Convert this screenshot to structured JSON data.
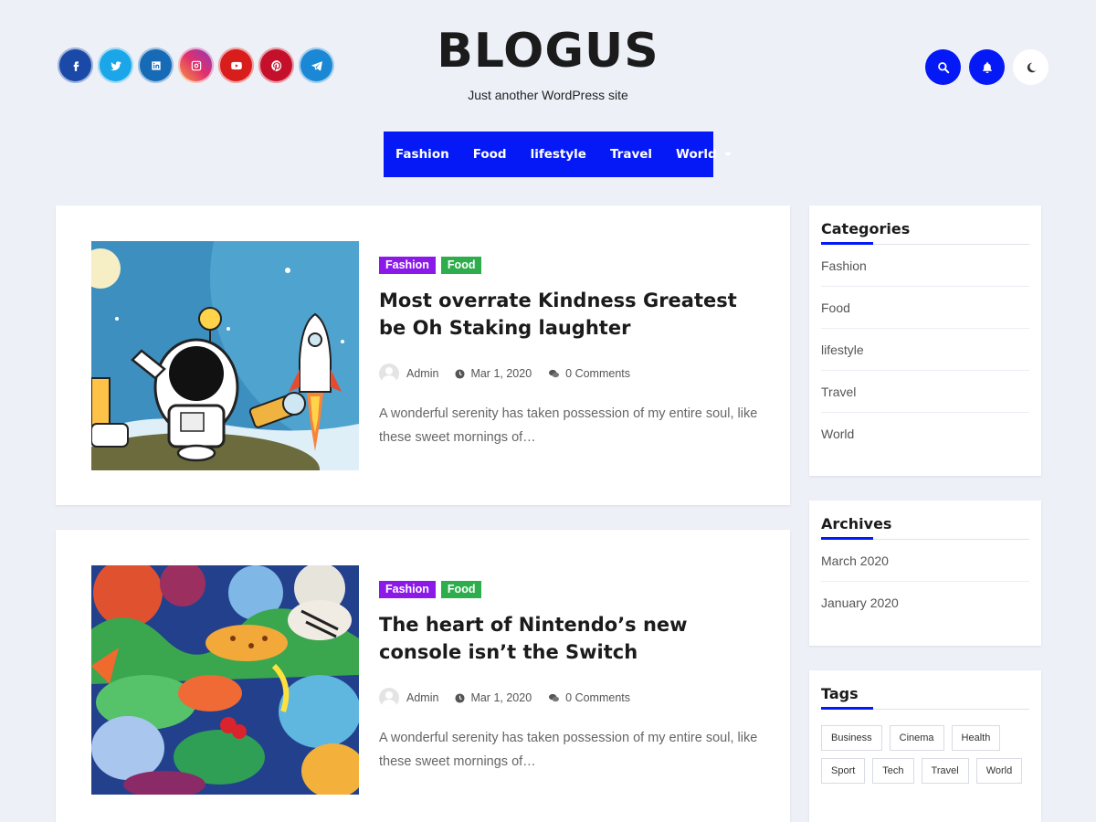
{
  "site": {
    "title": "BLOGUS",
    "tagline": "Just another WordPress site"
  },
  "social": [
    {
      "name": "facebook",
      "color": "#1a49a8",
      "icon": "facebook-icon"
    },
    {
      "name": "twitter",
      "color": "#1aa6e8",
      "icon": "twitter-icon"
    },
    {
      "name": "linkedin",
      "color": "#176ab5",
      "icon": "linkedin-icon"
    },
    {
      "name": "instagram",
      "color": "#c8319b",
      "icon": "instagram-icon"
    },
    {
      "name": "youtube",
      "color": "#d91c1c",
      "icon": "youtube-icon"
    },
    {
      "name": "pinterest",
      "color": "#c4102a",
      "icon": "pinterest-icon"
    },
    {
      "name": "telegram",
      "color": "#1a88d4",
      "icon": "telegram-icon"
    }
  ],
  "header_actions": {
    "search_icon": "search-icon",
    "bell_icon": "bell-icon",
    "theme_icon": "moon-icon"
  },
  "nav": {
    "items": [
      "Fashion",
      "Food",
      "lifestyle",
      "Travel",
      "World"
    ],
    "accent": "#0419f6"
  },
  "posts": [
    {
      "categories": [
        "Fashion",
        "Food"
      ],
      "title": "Most overrate Kindness Greatest be Oh Staking laughter",
      "author": "Admin",
      "date": "Mar 1, 2020",
      "comments": "0 Comments",
      "excerpt": "A wonderful serenity has taken possession of my entire soul, like these sweet mornings of…"
    },
    {
      "categories": [
        "Fashion",
        "Food"
      ],
      "title": "The heart of Nintendo’s new console isn’t the Switch",
      "author": "Admin",
      "date": "Mar 1, 2020",
      "comments": "0 Comments",
      "excerpt": "A wonderful serenity has taken possession of my entire soul, like these sweet mornings of…"
    }
  ],
  "sidebar": {
    "categories": {
      "title": "Categories",
      "items": [
        "Fashion",
        "Food",
        "lifestyle",
        "Travel",
        "World"
      ]
    },
    "archives": {
      "title": "Archives",
      "items": [
        "March 2020",
        "January 2020"
      ]
    },
    "tags": {
      "title": "Tags",
      "items": [
        "Business",
        "Cinema",
        "Health",
        "Sport",
        "Tech",
        "Travel",
        "World"
      ]
    }
  },
  "colors": {
    "category_fashion": "#8b1ae8",
    "category_food": "#2dad4c",
    "background": "#eef0f8"
  }
}
